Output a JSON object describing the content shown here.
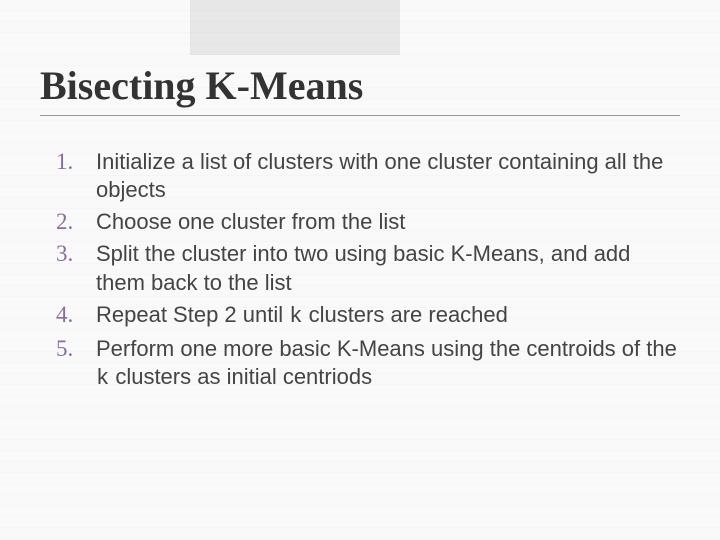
{
  "slide": {
    "title": "Bisecting K-Means",
    "items": [
      {
        "n": "1.",
        "text_a": "Initialize a list of clusters with one cluster containing all the objects"
      },
      {
        "n": "2.",
        "text_a": "Choose one cluster from the list"
      },
      {
        "n": "3.",
        "text_a": "Split the cluster into two using basic K-Means, and add them back to the list"
      },
      {
        "n": "4.",
        "text_a": "Repeat Step 2 until ",
        "code": "k",
        "text_b": " clusters are reached"
      },
      {
        "n": "5.",
        "text_a": "Perform one more basic K-Means using the centroids of the ",
        "code": "k",
        "text_b": " clusters as initial centriods"
      }
    ]
  }
}
